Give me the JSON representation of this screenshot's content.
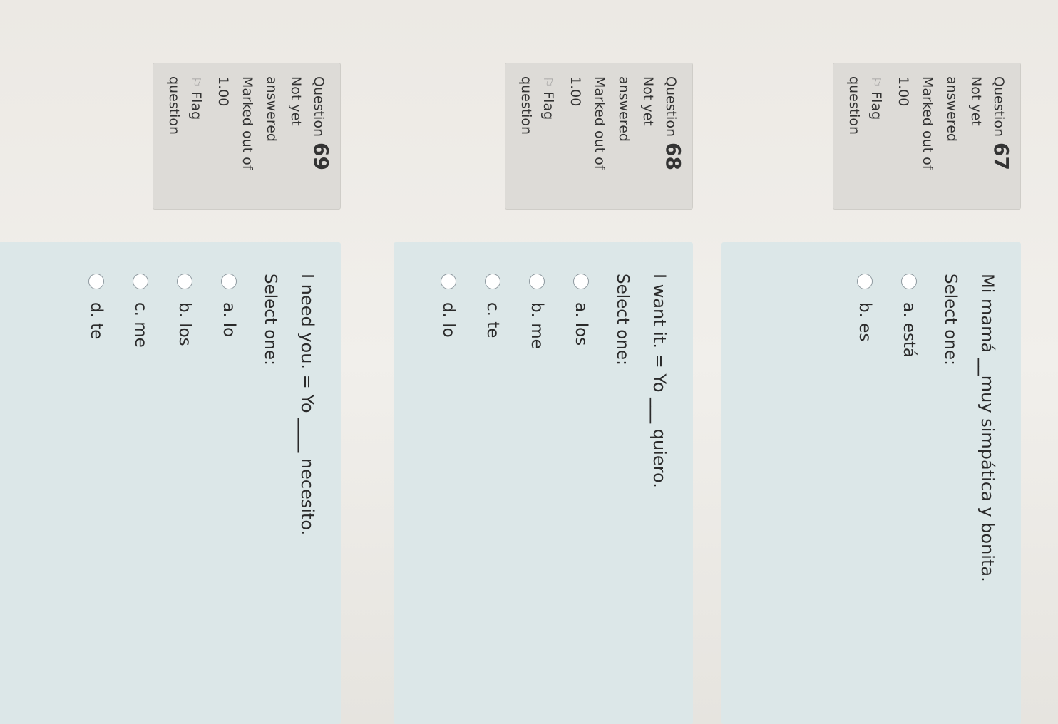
{
  "questions": [
    {
      "label": "Question",
      "number": "67",
      "state": [
        "Not yet",
        "answered"
      ],
      "grade": [
        "Marked out of",
        "1.00"
      ],
      "flag": [
        "Flag",
        "question"
      ],
      "text": "Mi mamá __muy simpática y bonita.",
      "prompt": "Select one:",
      "options": [
        "a. está",
        "b. es"
      ]
    },
    {
      "label": "Question",
      "number": "68",
      "state": [
        "Not yet",
        "answered"
      ],
      "grade": [
        "Marked out of",
        "1.00"
      ],
      "flag": [
        "Flag",
        "question"
      ],
      "text": "I want it. = Yo ___ quiero.",
      "prompt": "Select one:",
      "options": [
        "a. los",
        "b. me",
        "c. te",
        "d. lo"
      ]
    },
    {
      "label": "Question",
      "number": "69",
      "state": [
        "Not yet",
        "answered"
      ],
      "grade": [
        "Marked out of",
        "1.00"
      ],
      "flag": [
        "Flag",
        "question"
      ],
      "text": "I need you. = Yo ____ necesito.",
      "prompt": "Select one:",
      "options": [
        "a. lo",
        "b. los",
        "c. me",
        "d. te"
      ]
    }
  ],
  "icons": {
    "flag": "flag-icon",
    "radio": "radio-empty-icon"
  },
  "colors": {
    "info_bg": "#dddbd7",
    "content_bg": "#dce7e8",
    "page_bg": "#ece9e4"
  }
}
